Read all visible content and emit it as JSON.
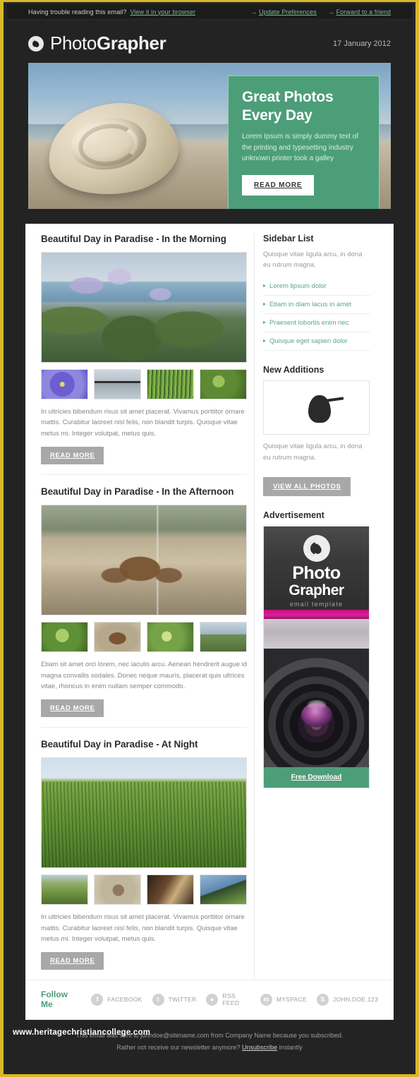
{
  "preheader": {
    "trouble_text": "Having trouble reading this email?",
    "browser_link": "View it in your browser",
    "arrow": "→",
    "update_link": "Update Preferences",
    "forward_link": "Forward to a friend"
  },
  "header": {
    "logo_light": "Photo",
    "logo_bold": "Grapher",
    "date": "17 January 2012",
    "logo_icon": "spiral-logo-icon"
  },
  "hero": {
    "title_line1": "Great Photos",
    "title_line2": "Every Day",
    "body": "Lorem Ipsum is simply dummy text of the printing and typesetting industry unknown printer took a galley",
    "button": "READ MORE"
  },
  "articles": [
    {
      "title": "Beautiful Day in Paradise - In the Morning",
      "body": "In ultricies bibendum risus sit amet placerat. Vivamus porttitor ornare mattis. Curabitur laoreet nisl felis, non blandit turpis. Quisque vitae metus mi. Integer volutpat, metus quis.",
      "button": "READ MORE"
    },
    {
      "title": "Beautiful Day in Paradise - In the Afternoon",
      "body": "Etiam sit amet orci lorem, nec iaculis arcu. Aenean hendrerit augue id magna convallis sodales. Donec neque mauris, placerat quis ultrices vitae, rhoncus in enim nullam semper commodo.",
      "button": "READ MORE"
    },
    {
      "title": "Beautiful Day in Paradise - At Night",
      "body": "In ultricies bibendum risus sit amet placerat. Vivamus porttitor ornare mattis. Curabitur laoreet nisl felis, non blandit turpis. Quisque vitae metus mi. Integer volutpat, metus quis.",
      "button": "READ MORE"
    }
  ],
  "sidebar": {
    "list_title": "Sidebar List",
    "list_intro": "Quisque vitae ligula arcu, in dona  eu rutrum magna.",
    "links": [
      "Lorem lipsum dolor",
      "Etiam in diam lacus in amet",
      "Praesent lobortis enim nec",
      "Quisque eget sapien dolor"
    ],
    "new_title": "New Additions",
    "new_text": "Quisque vitae ligula arcu, in dona  eu rutrum magna.",
    "new_button": "VIEW ALL PHOTOS",
    "ad_title": "Advertisement",
    "ad_word1": "Photo",
    "ad_word2": "Grapher",
    "ad_sub": "email template",
    "ad_button": "Free Download"
  },
  "follow": {
    "label": "Follow Me",
    "items": [
      {
        "icon": "facebook-icon",
        "glyph": "f",
        "label": "FACEBOOK"
      },
      {
        "icon": "twitter-icon",
        "glyph": "t",
        "label": "TWITTER"
      },
      {
        "icon": "rss-icon",
        "glyph": "●",
        "label": "RSS FEED"
      },
      {
        "icon": "myspace-icon",
        "glyph": "m",
        "label": "MYSPACE"
      },
      {
        "icon": "skype-icon",
        "glyph": "S",
        "label": "JOHN.DOE.123"
      }
    ]
  },
  "footer": {
    "line1": "This email was sent to johndoe@sitename.com from Company Name because you subscribed.",
    "line2_pre": "Rather not receive our newsletter anymore?",
    "line2_link": "Unsubscribe",
    "line2_post": "instantly",
    "watermark": "www.heritagechristiancollege.com"
  },
  "colors": {
    "accent_green": "#4c9e79",
    "frame_gold": "#d8b829",
    "page_dark": "#232323",
    "grey_button": "#a8a8a8"
  }
}
